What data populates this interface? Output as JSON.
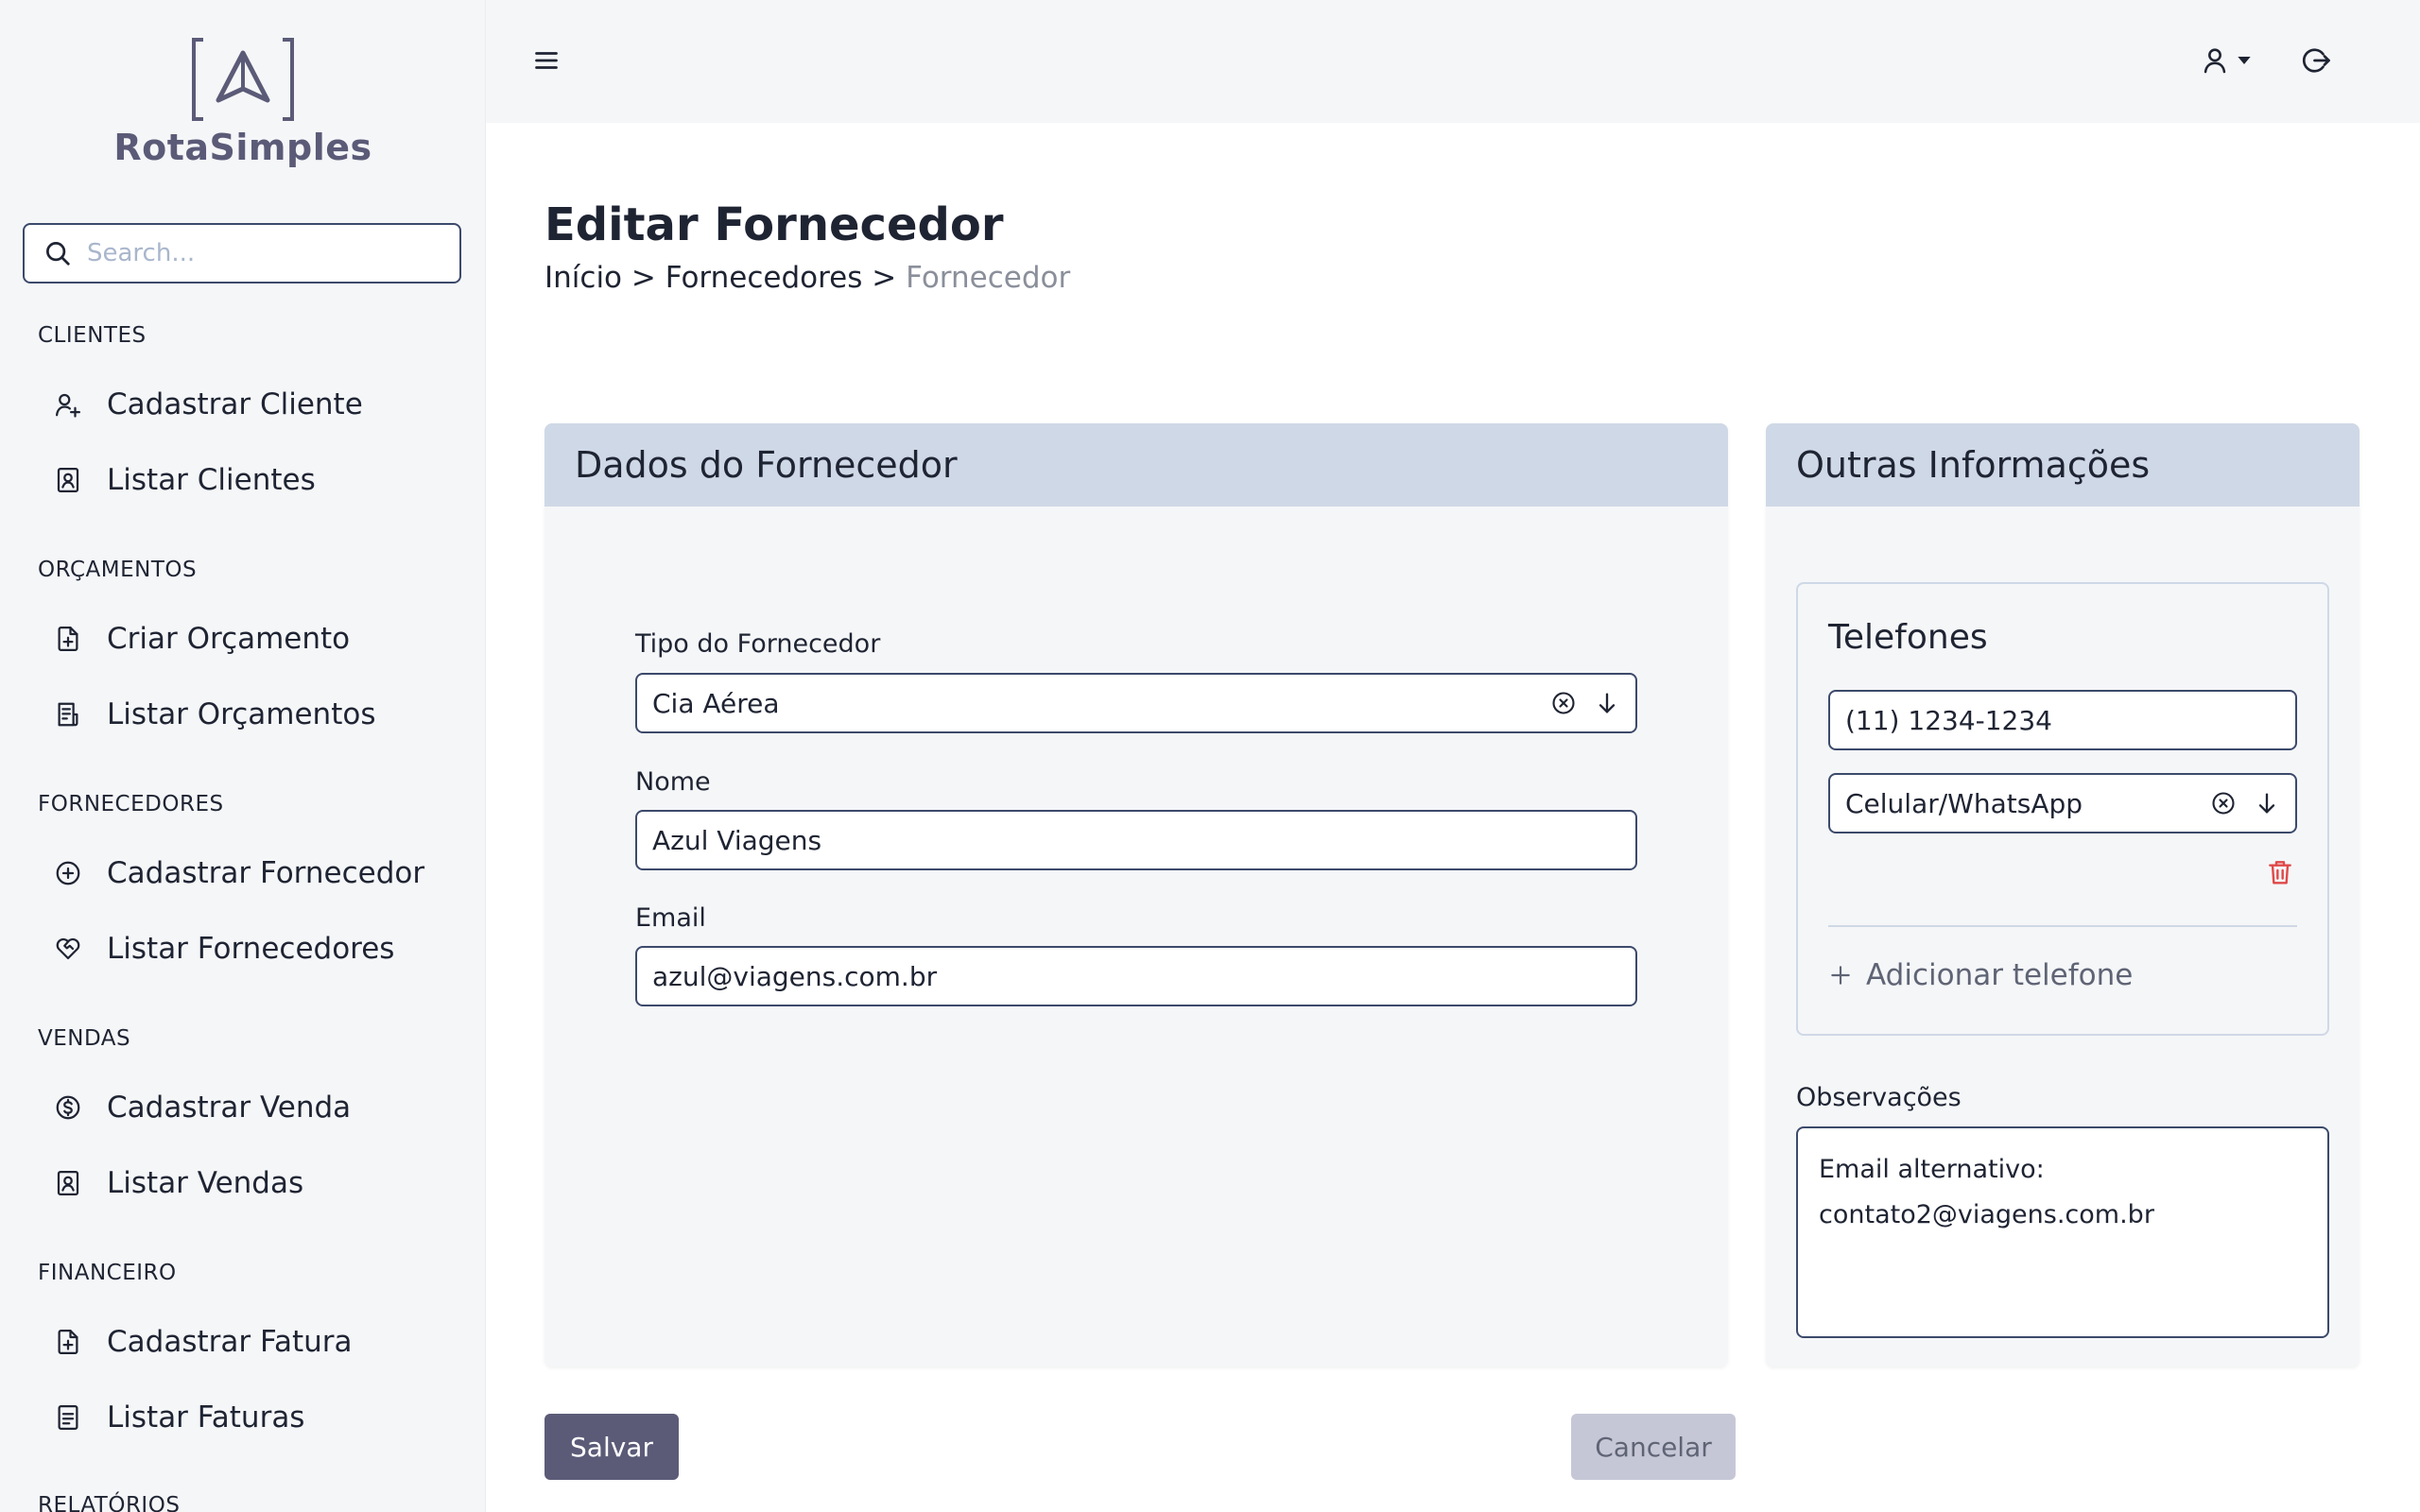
{
  "brand": {
    "name": "RotaSimples",
    "color": "#5b5b78"
  },
  "search": {
    "placeholder": "Search..."
  },
  "sidebar": {
    "sections": [
      {
        "title": "CLIENTES",
        "items": [
          {
            "label": "Cadastrar Cliente",
            "icon": "user-plus-icon"
          },
          {
            "label": "Listar Clientes",
            "icon": "contact-book-icon"
          }
        ]
      },
      {
        "title": "ORÇAMENTOS",
        "items": [
          {
            "label": "Criar Orçamento",
            "icon": "file-plus-icon"
          },
          {
            "label": "Listar Orçamentos",
            "icon": "file-list-icon"
          }
        ]
      },
      {
        "title": "FORNECEDORES",
        "items": [
          {
            "label": "Cadastrar Fornecedor",
            "icon": "circle-plus-icon"
          },
          {
            "label": "Listar Fornecedores",
            "icon": "heart-handshake-icon"
          }
        ]
      },
      {
        "title": "VENDAS",
        "items": [
          {
            "label": "Cadastrar Venda",
            "icon": "dollar-circle-icon"
          },
          {
            "label": "Listar Vendas",
            "icon": "contact-book-icon"
          }
        ]
      },
      {
        "title": "FINANCEIRO",
        "items": [
          {
            "label": "Cadastrar Fatura",
            "icon": "file-plus-icon"
          },
          {
            "label": "Listar Faturas",
            "icon": "file-text-icon"
          }
        ]
      },
      {
        "title": "RELATÓRIOS",
        "items": []
      }
    ]
  },
  "page": {
    "title": "Editar Fornecedor",
    "breadcrumb": [
      "Início",
      "Fornecedores",
      "Fornecedor"
    ],
    "breadcrumb_separator": ">"
  },
  "supplier_card": {
    "title": "Dados do Fornecedor",
    "type_label": "Tipo do Fornecedor",
    "type_value": "Cia Aérea",
    "name_label": "Nome",
    "name_value": "Azul Viagens",
    "email_label": "Email",
    "email_value": "azul@viagens.com.br"
  },
  "other_card": {
    "title": "Outras Informações",
    "phones_title": "Telefones",
    "phone_number": "(11) 1234-1234",
    "phone_type": "Celular/WhatsApp",
    "add_phone": "Adicionar telefone",
    "notes_label": "Observações",
    "notes_line1": "Email alternativo:",
    "notes_line2": "contato2@viagens.com.br"
  },
  "actions": {
    "save": "Salvar",
    "cancel": "Cancelar"
  },
  "colors": {
    "header_bg": "#cfd8e6",
    "danger": "#e04848",
    "primary": "#5b5b78"
  }
}
